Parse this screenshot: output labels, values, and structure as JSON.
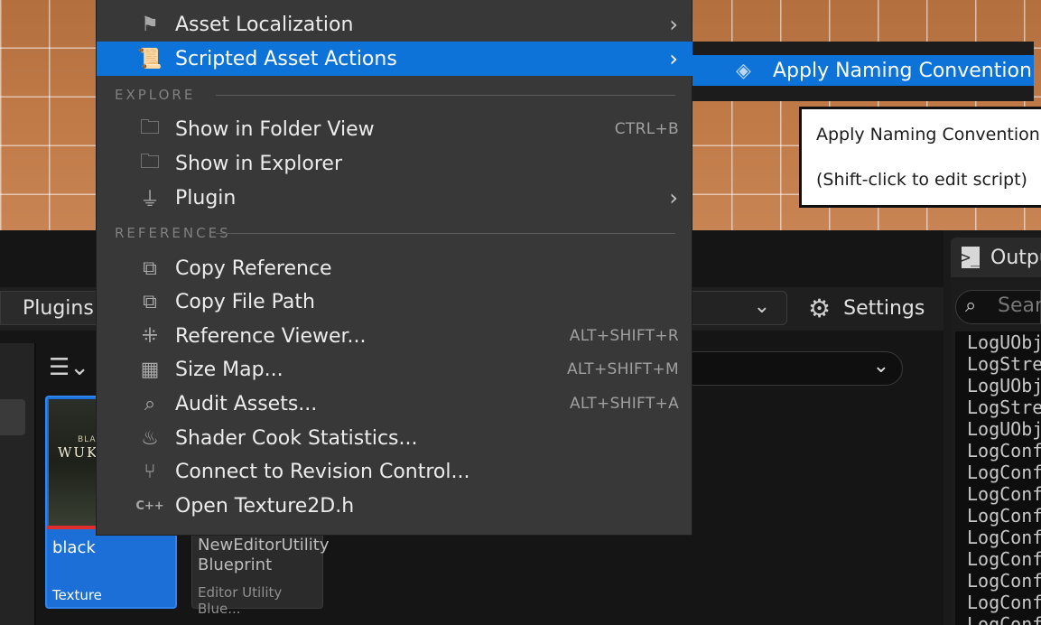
{
  "context_menu": {
    "items_top": [
      {
        "label": "Asset Localization",
        "icon": "flag-icon",
        "has_submenu": true
      },
      {
        "label": "Scripted Asset Actions",
        "icon": "script-icon",
        "has_submenu": true,
        "active": true
      }
    ],
    "explore": {
      "header": "EXPLORE",
      "items": [
        {
          "label": "Show in Folder View",
          "icon": "folder-search-icon",
          "shortcut": "CTRL+B"
        },
        {
          "label": "Show in Explorer",
          "icon": "folder-search-icon",
          "shortcut": ""
        },
        {
          "label": "Plugin",
          "icon": "plugin-icon",
          "has_submenu": true
        }
      ]
    },
    "references": {
      "header": "REFERENCES",
      "items": [
        {
          "label": "Copy Reference",
          "icon": "copy-reference-icon",
          "shortcut": ""
        },
        {
          "label": "Copy File Path",
          "icon": "copy-path-icon",
          "shortcut": ""
        },
        {
          "label": "Reference Viewer...",
          "icon": "reference-viewer-icon",
          "shortcut": "ALT+SHIFT+R"
        },
        {
          "label": "Size Map...",
          "icon": "size-map-icon",
          "shortcut": "ALT+SHIFT+M"
        },
        {
          "label": "Audit Assets...",
          "icon": "audit-icon",
          "shortcut": "ALT+SHIFT+A"
        },
        {
          "label": "Shader Cook Statistics...",
          "icon": "shader-icon",
          "shortcut": ""
        },
        {
          "label": "Connect to Revision Control...",
          "icon": "revision-control-icon",
          "shortcut": ""
        },
        {
          "label": "Open Texture2D.h",
          "icon": "cpp-icon",
          "shortcut": ""
        }
      ]
    }
  },
  "submenu": {
    "label": "Apply Naming Convention",
    "icon": "diamond-icon"
  },
  "tooltip": {
    "line1": "Apply Naming Convention",
    "line2": "(Shift-click to edit script)"
  },
  "content_browser": {
    "plugins_label": "Plugins",
    "settings_label": "Settings",
    "assets": [
      {
        "name": "black",
        "type": "Texture",
        "thumb_small": "BLACK MYTH",
        "thumb_big": "WUKONG"
      },
      {
        "name": "NewEditorUtility Blueprint",
        "type": "Editor Utility Blue..."
      }
    ]
  },
  "output_log": {
    "tab_label": "Outpu",
    "search_placeholder": "Sear",
    "lines": [
      "LogUObj",
      "LogStre",
      "LogUObj",
      "LogStre",
      "LogUObj",
      "LogConf",
      "LogConf",
      "LogConf",
      "LogConf",
      "LogConf",
      "LogConf",
      "LogConf",
      "LogConf",
      "LogConf"
    ]
  },
  "colors": {
    "accent": "#0d73d8",
    "menu_bg": "#383838",
    "error_line": "#e02d2d"
  }
}
